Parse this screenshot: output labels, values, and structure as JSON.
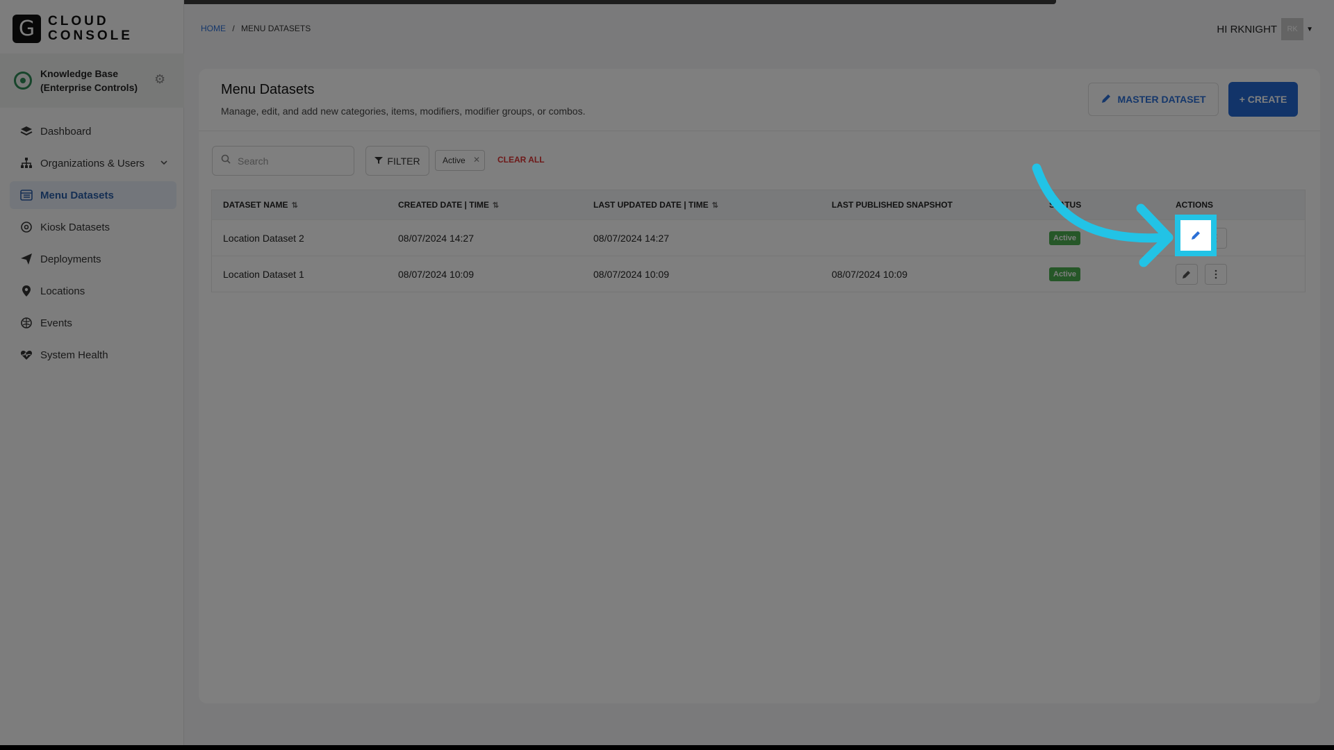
{
  "brand": {
    "logo_letter": "G",
    "line1": "CLOUD",
    "line2": "CONSOLE"
  },
  "org": {
    "name": "Knowledge Base (Enterprise Controls)"
  },
  "sidebar": {
    "items": [
      {
        "label": "Dashboard",
        "icon": "layers-icon"
      },
      {
        "label": "Organizations & Users",
        "icon": "org-tree-icon"
      },
      {
        "label": "Menu Datasets",
        "icon": "menu-dataset-icon"
      },
      {
        "label": "Kiosk Datasets",
        "icon": "kiosk-gear-icon"
      },
      {
        "label": "Deployments",
        "icon": "send-icon"
      },
      {
        "label": "Locations",
        "icon": "pin-icon"
      },
      {
        "label": "Events",
        "icon": "events-icon"
      },
      {
        "label": "System Health",
        "icon": "heart-pulse-icon"
      }
    ]
  },
  "breadcrumb": {
    "home": "HOME",
    "separator": "/",
    "current": "MENU DATASETS"
  },
  "user": {
    "greeting": "HI RKNIGHT",
    "initials": "RK"
  },
  "page": {
    "title": "Menu Datasets",
    "subtitle": "Manage, edit, and add new categories, items, modifiers, modifier groups, or combos.",
    "master_label": "MASTER DATASET",
    "create_label": "+ CREATE"
  },
  "filters": {
    "search_placeholder": "Search",
    "filter_label": "FILTER",
    "chip": "Active",
    "clear_label": "CLEAR ALL"
  },
  "table": {
    "columns": [
      "DATASET NAME",
      "CREATED DATE | TIME",
      "LAST UPDATED DATE | TIME",
      "LAST PUBLISHED SNAPSHOT",
      "STATUS",
      "ACTIONS"
    ],
    "rows": [
      {
        "name": "Location Dataset 2",
        "created": "08/07/2024 14:27",
        "updated": "08/07/2024 14:27",
        "published": "",
        "status": "Active"
      },
      {
        "name": "Location Dataset 1",
        "created": "08/07/2024 10:09",
        "updated": "08/07/2024 10:09",
        "published": "08/07/2024 10:09",
        "status": "Active"
      }
    ]
  },
  "colors": {
    "accent": "#2469d3",
    "active_badge": "#4caf50",
    "highlight": "#22c3e6",
    "danger": "#dd3333"
  }
}
